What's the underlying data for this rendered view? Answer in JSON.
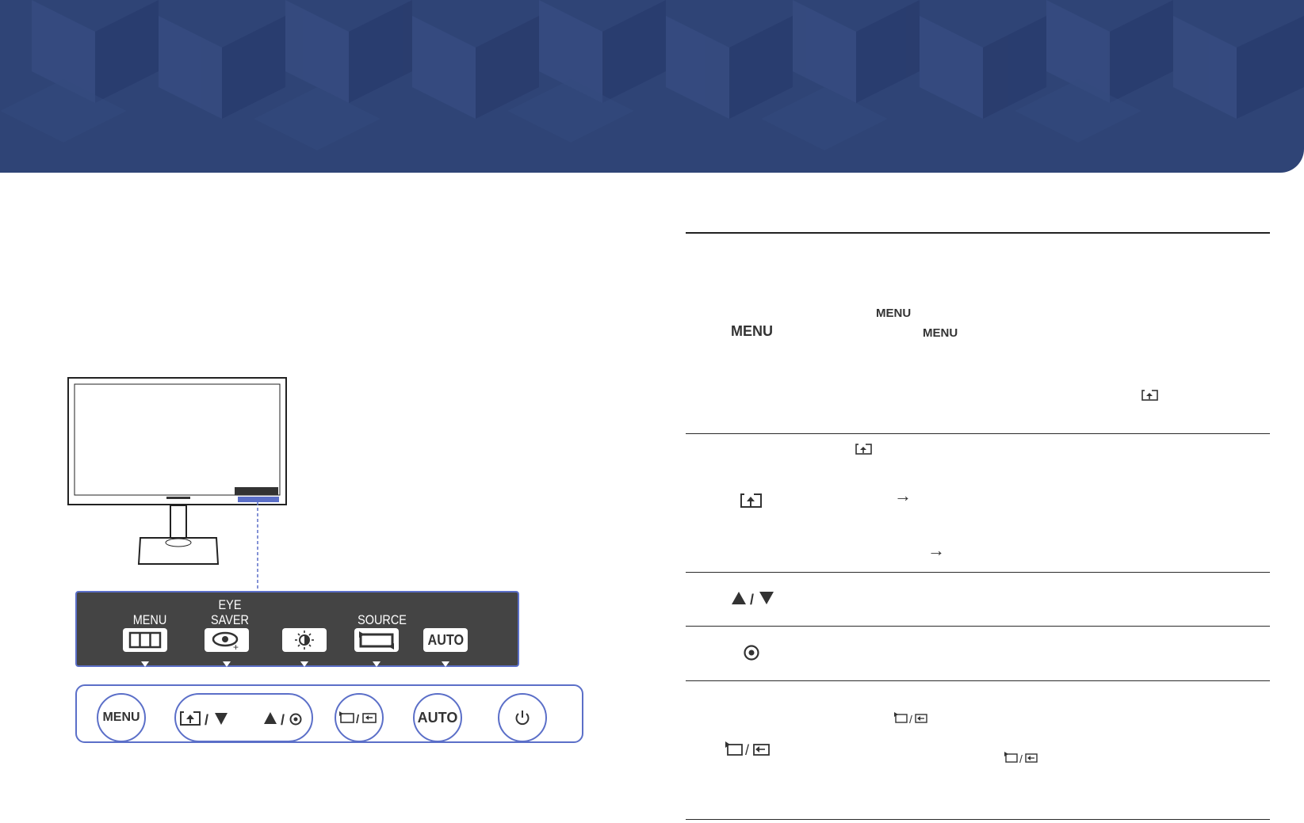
{
  "panel": {
    "labels": {
      "menu": "MENU",
      "eye_saver": "EYE\nSAVER",
      "source": "SOURCE",
      "auto": "AUTO"
    }
  },
  "control_bar": {
    "menu": "MENU",
    "auto": "AUTO"
  },
  "table": {
    "row1": {
      "key": "MENU",
      "inline1": "MENU",
      "inline2": "MENU"
    },
    "row2": {
      "arrow1": "→",
      "arrow2": "→"
    },
    "row5": {
      "slash": "/"
    }
  },
  "colors": {
    "banner": "#2f4476",
    "accent": "#5b6fc8",
    "panel": "#444444"
  }
}
